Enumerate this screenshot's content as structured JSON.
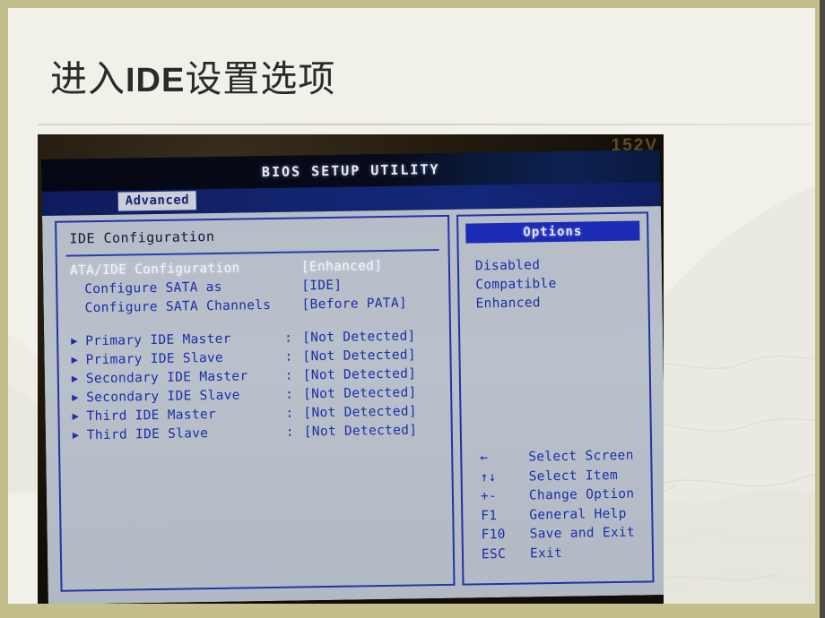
{
  "slide": {
    "title_prefix": "进入",
    "title_latin": "IDE",
    "title_suffix": "设置选项",
    "border_color": "#c3bf8d",
    "background_color": "#f1f0e9"
  },
  "photo": {
    "bezel_label": "152V"
  },
  "bios": {
    "header_title": "BIOS SETUP UTILITY",
    "active_tab": "Advanced",
    "section_title": "IDE Configuration",
    "accent_color": "#1b2fa8",
    "screen_bg": "#b6bdc8",
    "settings": [
      {
        "label": "ATA/IDE Configuration",
        "value": "[Enhanced]",
        "indent": false,
        "selected": true,
        "arrow": false,
        "colon": false
      },
      {
        "label": "Configure SATA as",
        "value": "[IDE]",
        "indent": true,
        "selected": false,
        "arrow": false,
        "colon": false
      },
      {
        "label": "Configure SATA Channels",
        "value": "[Before PATA]",
        "indent": true,
        "selected": false,
        "arrow": false,
        "colon": false
      }
    ],
    "devices": [
      {
        "label": "Primary IDE Master",
        "colon": ":",
        "value": "[Not Detected]"
      },
      {
        "label": "Primary IDE Slave",
        "colon": ":",
        "value": "[Not Detected]"
      },
      {
        "label": "Secondary IDE Master",
        "colon": ":",
        "value": "[Not Detected]"
      },
      {
        "label": "Secondary IDE Slave",
        "colon": ":",
        "value": "[Not Detected]"
      },
      {
        "label": "Third IDE Master",
        "colon": ":",
        "value": "[Not Detected]"
      },
      {
        "label": "Third IDE Slave",
        "colon": ":",
        "value": "[Not Detected]"
      }
    ],
    "options_panel": {
      "header": "Options",
      "items": [
        "Disabled",
        "Compatible",
        "Enhanced"
      ]
    },
    "help_keys": [
      {
        "key": "←",
        "desc": "Select Screen"
      },
      {
        "key": "↑↓",
        "desc": "Select Item"
      },
      {
        "key": "+-",
        "desc": "Change Option"
      },
      {
        "key": "F1",
        "desc": "General Help"
      },
      {
        "key": "F10",
        "desc": "Save and Exit"
      },
      {
        "key": "ESC",
        "desc": "Exit"
      }
    ]
  }
}
